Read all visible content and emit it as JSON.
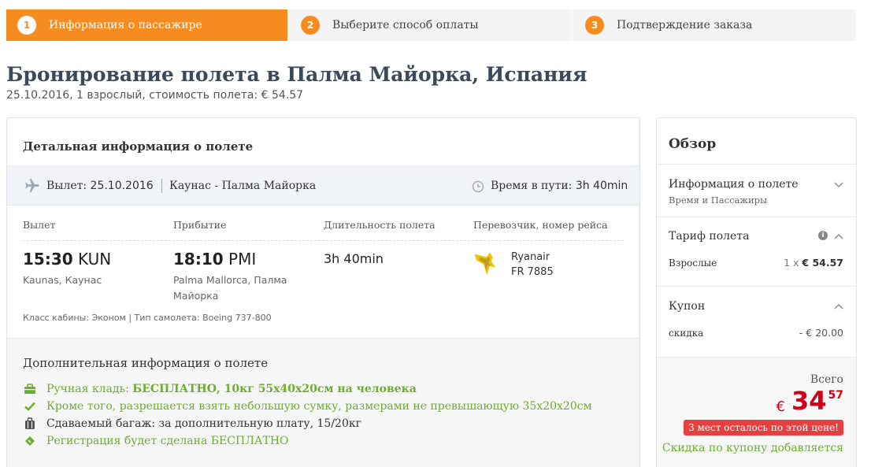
{
  "steps": [
    {
      "num": "1",
      "label": "Информация о пассажире"
    },
    {
      "num": "2",
      "label": "Выберите способ оплаты"
    },
    {
      "num": "3",
      "label": "Подтверждение заказа"
    }
  ],
  "title": "Бронирование полета в Палма Майорка, Испания",
  "subtitle": "25.10.2016, 1 взрослый, стоимость полета: € 54.57",
  "flight": {
    "header": "Детальная информация о полете",
    "dep_label": "Вылет:",
    "dep_date": "25.10.2016",
    "route": "Каунас - Палма Майорка",
    "travel_label": "Время в пути:",
    "travel_time": "3h 40min",
    "col_departure": "Вылет",
    "col_arrival": "Прибытие",
    "col_duration": "Длительность полета",
    "col_carrier": "Перевозчик, номер рейса",
    "dep_time": "15:30",
    "dep_code": "KUN",
    "dep_place": "Kaunas, Каунас",
    "arr_time": "18:10",
    "arr_code": "PMI",
    "arr_place_1": "Palma Mallorca, Палма",
    "arr_place_2": "Майорка",
    "duration": "3h 40min",
    "carrier_name": "Ryanair",
    "flight_no": "FR 7885",
    "cabin_info": "Класс кабины: Эконом  |   Тип самолета: Boeing 737-800"
  },
  "extra": {
    "title": "Дополнительная информация о полете",
    "items": [
      {
        "icon": "briefcase-icon",
        "text_a": "Ручная кладь: ",
        "text_b": "БЕСПЛАТНО, 10кг 55x40x20см на человека"
      },
      {
        "icon": "check-icon",
        "text": "Кроме того, разрешается взять небольшую сумку, размерами не превышающую 35x20x20см"
      },
      {
        "icon": "luggage-icon",
        "text": "Сдаваемый багаж:  за дополнительную плату, 15/20кг"
      },
      {
        "icon": "ticket-icon",
        "text": "Регистрация будет сделана БЕСПЛАТНО"
      }
    ]
  },
  "summary": {
    "title": "Обзор",
    "flight_info": "Информация о полете",
    "flight_info_sub": "Время и Пассажиры",
    "tariff": "Тариф полета",
    "adults_label": "Взрослые",
    "adults_qty": "1 x",
    "adults_price": "€ 54.57",
    "coupon": "Купон",
    "discount_label": "скидка",
    "discount_value": "- € 20.00",
    "total_label": "Всего",
    "currency": "€",
    "total_int": "34",
    "total_dec": "57",
    "badge": "3 мест осталось по этой цене!",
    "coupon_note": "Скидка по купону добавляется"
  },
  "colors": {
    "accent": "#f68b1f",
    "green": "#6cae2e",
    "price_red": "#d0021b",
    "badge_red": "#e5403f"
  }
}
